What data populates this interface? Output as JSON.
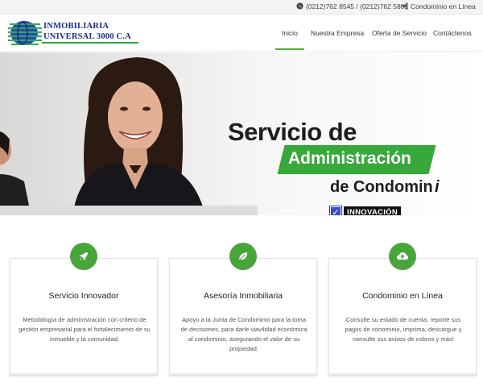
{
  "topbar": {
    "phone_icon": "phone-icon",
    "phone": "(0212)762 8545 / (0212)762 5801",
    "login_icon": "sign-in-icon",
    "login": "Condominio en Línea"
  },
  "logo": {
    "line1": "INMOBILIARIA",
    "line2": "UNIVERSAL 3000 C.A"
  },
  "nav": {
    "items": [
      "Inicio",
      "Nuestra Empresa",
      "Oferta de Servicio",
      "Contáctenos"
    ],
    "active": "Inicio"
  },
  "hero": {
    "title1": "Servicio de",
    "title2": "Administración",
    "title3": "de Condomin",
    "title3_tail": "i",
    "badge": "INNOVACIÓN"
  },
  "cards": [
    {
      "icon": "rocket-icon",
      "title": "Servicio Innovador",
      "desc": "Metodología de administración con criterio de gestión empresarial para el fortalecimiento de su inmueble y la comunidad."
    },
    {
      "icon": "leaf-icon",
      "title": "Asesoría Inmobiliaria",
      "desc": "Apoyo a la Junta de Condominio para la toma de decisiones, para darle viavilidad económica al condominio, asegurando el valor de su propiedad."
    },
    {
      "icon": "cloud-upload-icon",
      "title": "Condominio en Línea",
      "desc": "Consulte su estado de cuenta, reporte sus pagos de conominio, imprima, descargue y consulte sus avisos de cobros y más!"
    }
  ],
  "colors": {
    "accent_green": "#48a53a",
    "logo_blue": "#1a2b8c",
    "badge_blue": "#3c4ec8"
  }
}
